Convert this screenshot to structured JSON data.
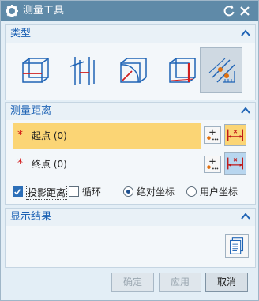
{
  "window": {
    "title": "测量工具"
  },
  "type_section": {
    "title": "类型",
    "buttons": [
      {
        "icon": "distance-between-faces-icon",
        "active": false
      },
      {
        "icon": "distance-between-edges-icon",
        "active": false
      },
      {
        "icon": "arc-radius-icon",
        "active": false
      },
      {
        "icon": "distance-point-to-face-icon",
        "active": false
      },
      {
        "icon": "distance-point-to-point-icon",
        "active": true
      }
    ]
  },
  "measure_section": {
    "title": "测量距离",
    "start": {
      "label": "起点 (0)"
    },
    "end": {
      "label": "终点 (0)"
    },
    "options": {
      "projection": "投影距离",
      "loop": "循环",
      "absolute": "绝对坐标",
      "user": "用户坐标"
    }
  },
  "result_section": {
    "title": "显示结果"
  },
  "footer": {
    "ok": "确定",
    "apply": "应用",
    "cancel": "取消"
  },
  "colors": {
    "title_bar": "#5f8aa8",
    "accent": "#1e63b5",
    "highlight": "#fbd575"
  }
}
